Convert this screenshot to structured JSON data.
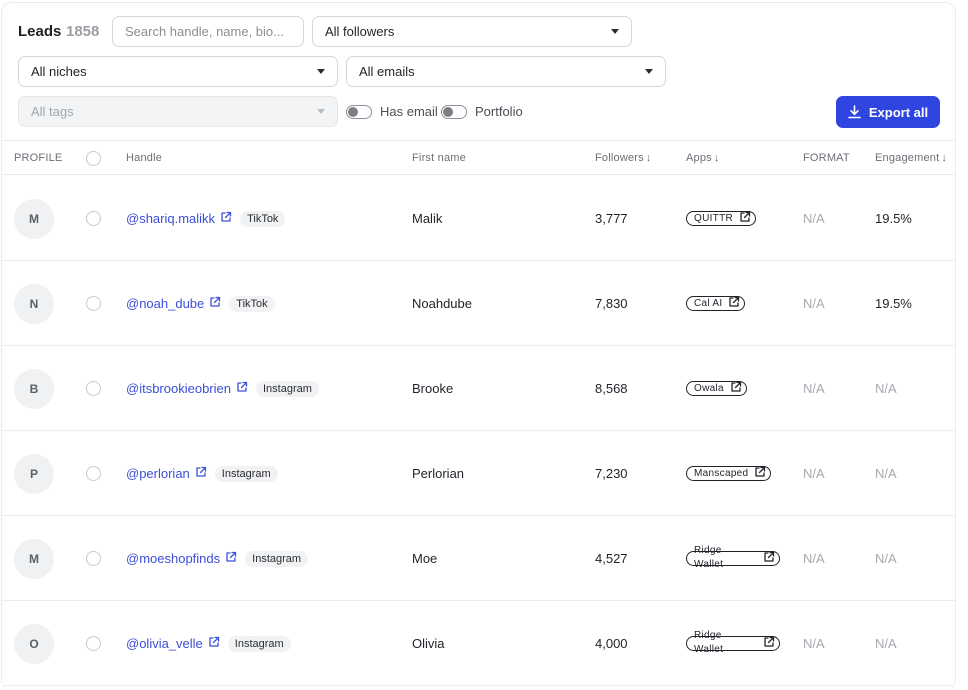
{
  "header": {
    "title": "Leads",
    "count": "1858"
  },
  "filters": {
    "search_placeholder": "Search handle, name, bio...",
    "followers": "All followers",
    "niches": "All niches",
    "emails": "All emails",
    "tags": "All tags",
    "has_email_label": "Has email",
    "portfolio_label": "Portfolio",
    "export_label": "Export all"
  },
  "columns": {
    "profile": "PROFILE",
    "handle": "Handle",
    "first_name": "First name",
    "followers": "Followers",
    "apps": "Apps",
    "format": "FORMAT",
    "engagement": "Engagement"
  },
  "rows": [
    {
      "initial": "M",
      "handle": "@shariq.malikk",
      "platform": "TikTok",
      "first_name": "Malik",
      "followers": "3,777",
      "app_line1": "QUITTR",
      "app_line2": "",
      "format": "N/A",
      "engagement": "19.5%"
    },
    {
      "initial": "N",
      "handle": "@noah_dube",
      "platform": "TikTok",
      "first_name": "Noahdube",
      "followers": "7,830",
      "app_line1": "Cal AI",
      "app_line2": "",
      "format": "N/A",
      "engagement": "19.5%"
    },
    {
      "initial": "B",
      "handle": "@itsbrookieobrien",
      "platform": "Instagram",
      "first_name": "Brooke",
      "followers": "8,568",
      "app_line1": "Owala",
      "app_line2": "",
      "format": "N/A",
      "engagement": "N/A"
    },
    {
      "initial": "P",
      "handle": "@perlorian",
      "platform": "Instagram",
      "first_name": "Perlorian",
      "followers": "7,230",
      "app_line1": "Manscaped",
      "app_line2": "",
      "format": "N/A",
      "engagement": "N/A"
    },
    {
      "initial": "M",
      "handle": "@moeshopfinds",
      "platform": "Instagram",
      "first_name": "Moe",
      "followers": "4,527",
      "app_line1": "Ridge",
      "app_line2": "Wallet",
      "format": "N/A",
      "engagement": "N/A"
    },
    {
      "initial": "O",
      "handle": "@olivia_velle",
      "platform": "Instagram",
      "first_name": "Olivia",
      "followers": "4,000",
      "app_line1": "Ridge",
      "app_line2": "Wallet",
      "format": "N/A",
      "engagement": "N/A"
    }
  ],
  "colors": {
    "accent": "#2f45e0",
    "link": "#3b4fd8"
  }
}
